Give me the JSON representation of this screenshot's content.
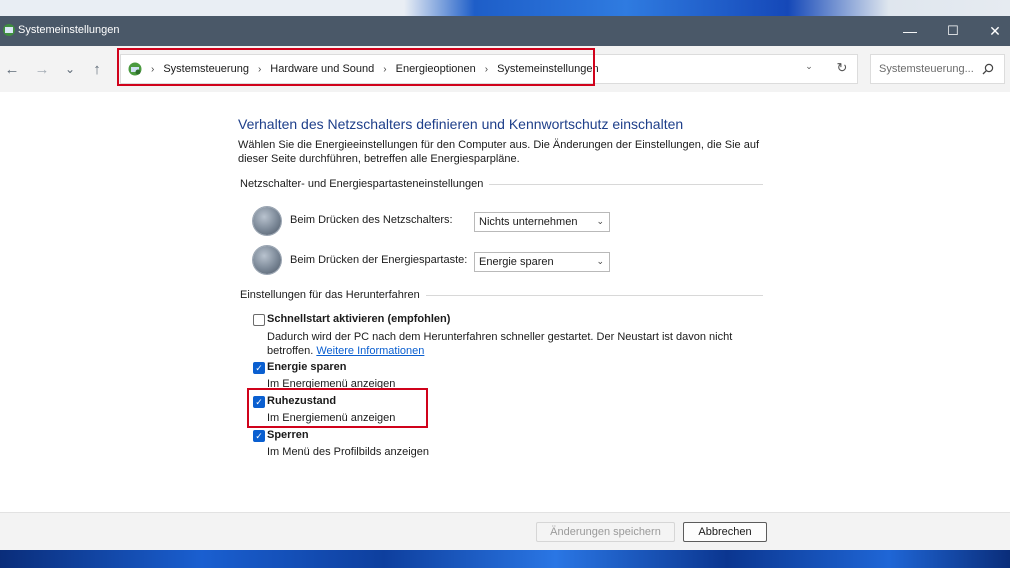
{
  "window": {
    "title": "Systemeinstellungen",
    "controls": {
      "minimize": "—",
      "maximize": "☐",
      "close": "✕"
    }
  },
  "nav": {
    "back": "←",
    "forward": "→",
    "recent": "⌄",
    "up": "↑"
  },
  "breadcrumb": {
    "items": [
      "Systemsteuerung",
      "Hardware und Sound",
      "Energieoptionen",
      "Systemeinstellungen"
    ],
    "separator": "›"
  },
  "addressbar": {
    "dropdown": "⌄",
    "refresh": "↻"
  },
  "search": {
    "placeholder": "Systemsteuerung..."
  },
  "page": {
    "heading": "Verhalten des Netzschalters definieren und Kennwortschutz einschalten",
    "intro": "Wählen Sie die Energieeinstellungen für den Computer aus. Die Änderungen der Einstellungen, die Sie auf dieser Seite durchführen, betreffen alle Energiesparpläne."
  },
  "buttons_section": {
    "title": "Netzschalter- und Energiespartasteneinstellungen",
    "rows": [
      {
        "label": "Beim Drücken des Netzschalters:",
        "value": "Nichts unternehmen"
      },
      {
        "label": "Beim Drücken der Energiespartaste:",
        "value": "Energie sparen"
      }
    ]
  },
  "shutdown_section": {
    "title": "Einstellungen für das Herunterfahren",
    "items": [
      {
        "title": "Schnellstart aktivieren (empfohlen)",
        "checked": false,
        "desc": "Dadurch wird der PC nach dem Herunterfahren schneller gestartet. Der Neustart ist davon nicht betroffen.",
        "link": "Weitere Informationen"
      },
      {
        "title": "Energie sparen",
        "checked": true,
        "desc": "Im Energiemenü anzeigen"
      },
      {
        "title": "Ruhezustand",
        "checked": true,
        "desc": "Im Energiemenü anzeigen"
      },
      {
        "title": "Sperren",
        "checked": true,
        "desc": "Im Menü des Profilbilds anzeigen"
      }
    ],
    "checkmark": "✓"
  },
  "footer": {
    "save": "Änderungen speichern",
    "cancel": "Abbrechen"
  },
  "colors": {
    "highlight": "#d0021b",
    "accent": "#0a5fd0",
    "heading": "#1e3f8a",
    "titlebar": "#4a5868"
  }
}
